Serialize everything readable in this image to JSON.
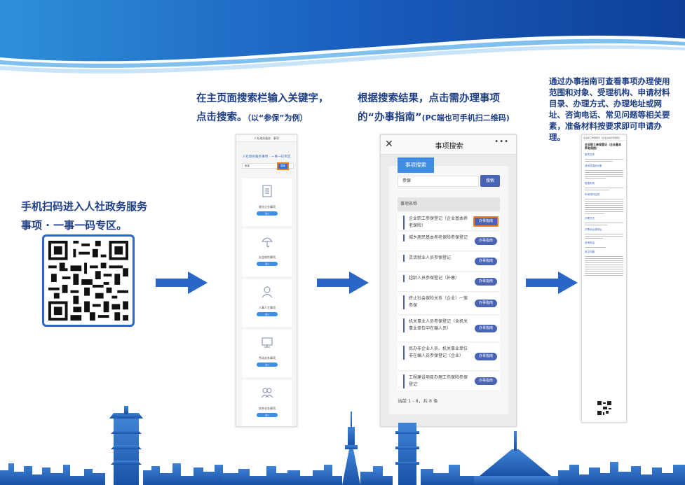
{
  "steps": {
    "step1": {
      "line1": "手机扫码进入人社政务服务",
      "line2": "事项 · 一事一码专区。"
    },
    "step2": {
      "line1": "在主页面搜索栏输入关键字，",
      "line2": "点击搜索。",
      "note": "（以“参保”为例）"
    },
    "step3": {
      "line1": "根据搜索结果，点击需办理事项",
      "line2": "的“办事指南”",
      "note": "(PC端也可手机扫二维码)"
    },
    "step4": {
      "text": "通过办事指南可查看事项办理使用范围和对象、受理机构、申请材料目录、办理方式、办理地址或网址、咨询电话、常见问题等相关要素，准备材料按要求即可申请办理。"
    }
  },
  "phone1": {
    "title": "人社政务服务 · 事项",
    "header": "人社政务服务事项 · 一事一码专区",
    "search_value": "参保",
    "search_button": "搜索",
    "cards": [
      {
        "label": "就业企业事项",
        "button": "进入",
        "icon": "document-icon"
      },
      {
        "label": "社会保险事项",
        "button": "进入",
        "icon": "umbrella-icon"
      },
      {
        "label": "人事人才事项",
        "button": "进入",
        "icon": "person-icon"
      },
      {
        "label": "劳动关系事项",
        "button": "进入",
        "icon": "monitor-icon"
      },
      {
        "label": "综合业务事项",
        "button": "进入",
        "icon": "people-icon"
      }
    ]
  },
  "phone2": {
    "title": "事项搜索",
    "tab": "事项搜索",
    "search_value": "参保",
    "search_button": "搜索",
    "column_header": "事项名称",
    "rows": [
      {
        "name": "企业职工参保登记（企业基本养老保险）",
        "button": "办事指南"
      },
      {
        "name": "城乡居民基本养老保险参保登记",
        "button": "办事指南"
      },
      {
        "name": "灵活就业人员参保登记",
        "button": "办事指南"
      },
      {
        "name": "超龄人员参保登记（补缴）",
        "button": "办事指南"
      },
      {
        "name": "终止社会保险关系（企业）一案参保",
        "button": "办事指南"
      },
      {
        "name": "机关事业人员参保登记（含机关事业单位中在编人员）",
        "button": "办事指南"
      },
      {
        "name": "民办非企业人员、机关事业单位非在编人员参保登记（企业）",
        "button": "办事指南"
      },
      {
        "name": "工程建设项目办理工伤保险参保登记",
        "button": "办事指南"
      }
    ],
    "footer": "当前 1 - 8，共 8 条"
  },
  "doc": {
    "top": "企业职工参保登记（企业基本养老保险）",
    "title": "企业职工参保登记（企业基本养老保险）",
    "sections": [
      "事项名称",
      "适用范围和对象",
      "受理机构",
      "申请材料目录",
      "办理方式",
      "办理地址或网址",
      "咨询电话",
      "常见问题"
    ]
  },
  "colors": {
    "primary": "#1f3f86",
    "accent": "#f07b21",
    "button": "#4a64b5",
    "sky": "#2a66c6"
  }
}
